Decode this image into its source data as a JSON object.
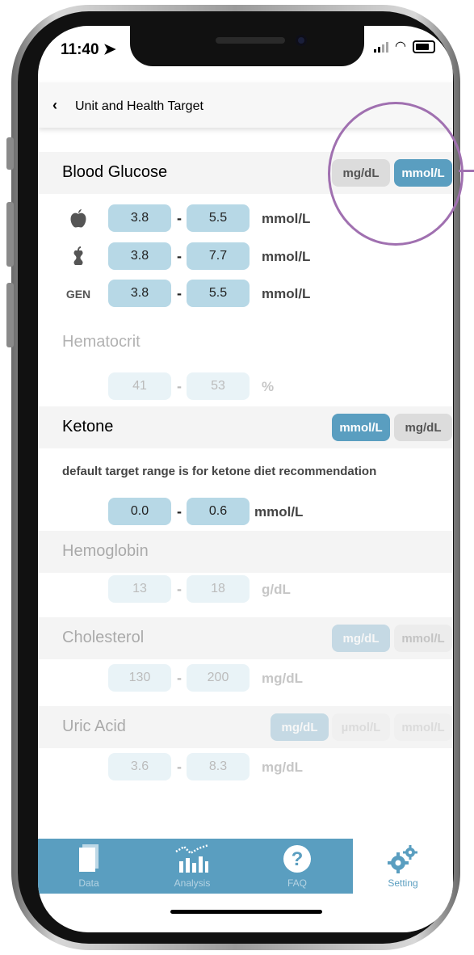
{
  "status": {
    "time": "11:40"
  },
  "nav": {
    "back_icon": "chevron-left-icon",
    "title": "Unit and Health Target"
  },
  "blood_glucose": {
    "title": "Blood Glucose",
    "units": [
      "mg/dL",
      "mmol/L"
    ],
    "selected_unit": "mmol/L",
    "rows": [
      {
        "icon": "apple-icon",
        "min": "3.8",
        "max": "5.5",
        "unit": "mmol/L"
      },
      {
        "icon": "apple-core-icon",
        "min": "3.8",
        "max": "7.7",
        "unit": "mmol/L"
      },
      {
        "label": "GEN",
        "min": "3.8",
        "max": "5.5",
        "unit": "mmol/L"
      }
    ]
  },
  "hematocrit": {
    "title": "Hematocrit",
    "min": "41",
    "max": "53",
    "unit": "%"
  },
  "ketone": {
    "title": "Ketone",
    "units": [
      "mmol/L",
      "mg/dL"
    ],
    "selected_unit": "mmol/L",
    "note": "default target range is for ketone diet recommendation",
    "min": "0.0",
    "max": "0.6",
    "unit": "mmol/L"
  },
  "hemoglobin": {
    "title": "Hemoglobin",
    "min": "13",
    "max": "18",
    "unit": "g/dL"
  },
  "cholesterol": {
    "title": "Cholesterol",
    "units": [
      "mg/dL",
      "mmol/L"
    ],
    "selected_unit": "mg/dL",
    "min": "130",
    "max": "200",
    "unit": "mg/dL"
  },
  "uric_acid": {
    "title": "Uric Acid",
    "units": [
      "mg/dL",
      "µmol/L",
      "mmol/L"
    ],
    "selected_unit": "mg/dL",
    "min": "3.6",
    "max": "8.3",
    "unit": "mg/dL"
  },
  "range_separator": "-",
  "tabs": [
    {
      "label": "Data",
      "icon": "document-icon"
    },
    {
      "label": "Analysis",
      "icon": "chart-icon"
    },
    {
      "label": "FAQ",
      "icon": "question-icon"
    },
    {
      "label": "Setting",
      "icon": "gears-icon",
      "active": true
    }
  ],
  "colors": {
    "accent": "#5a9ec0",
    "range_box": "#b7d8e6",
    "highlight_circle": "#a070b0"
  }
}
